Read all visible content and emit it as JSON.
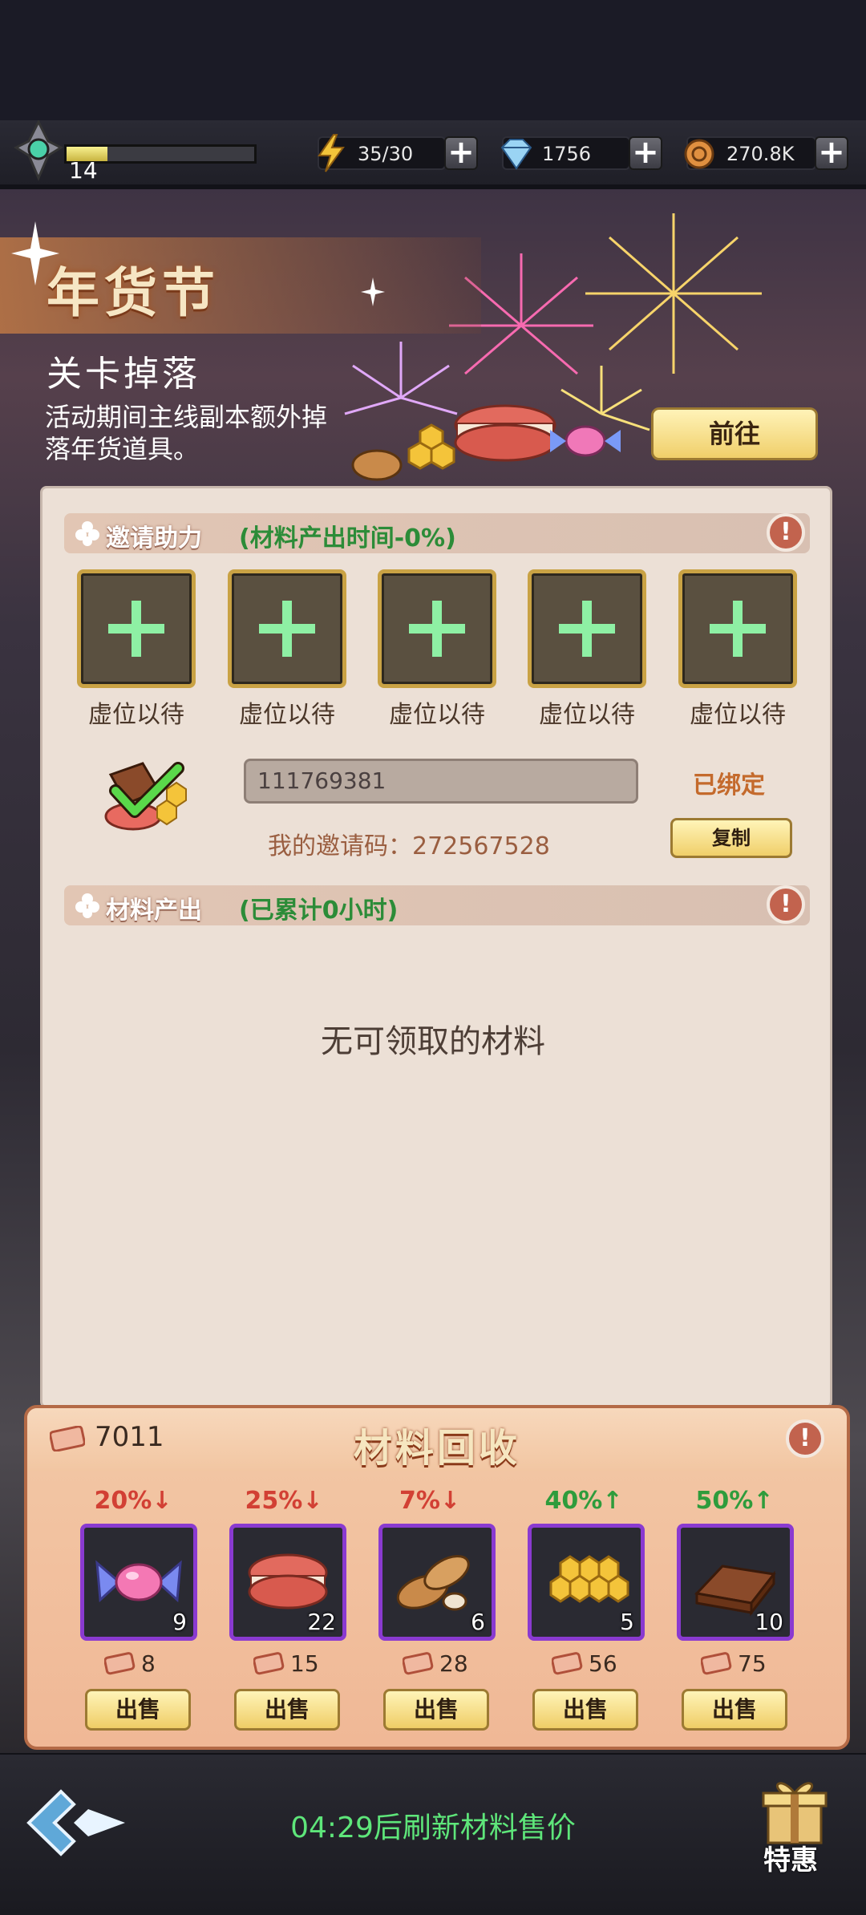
{
  "topbar": {
    "level": "14",
    "xp_progress": 0.22,
    "energy": "35/30",
    "gems": "1756",
    "coins": "270.8K"
  },
  "event": {
    "title": "年货节",
    "subtitle": "关卡掉落",
    "description": "活动期间主线副本额外掉落年货道具。",
    "goto_label": "前往"
  },
  "invite": {
    "header": "邀请助力",
    "hint": "(材料产出时间-0%)",
    "slot_label": "虚位以待",
    "slots": [
      "虚位以待",
      "虚位以待",
      "虚位以待",
      "虚位以待",
      "虚位以待"
    ],
    "bound_id": "111769381",
    "bound_status": "已绑定",
    "my_code": "我的邀请码：272567528",
    "copy_label": "复制"
  },
  "output": {
    "header": "材料产出",
    "hint": "(已累计0小时)",
    "empty_message": "无可领取的材料"
  },
  "recycle": {
    "title": "材料回收",
    "coupon_count": "7011",
    "sell_label": "出售",
    "items": [
      {
        "icon": "candy-icon",
        "rate": "20%↓",
        "trend": "down",
        "qty": "9",
        "price": "8"
      },
      {
        "icon": "macaron-icon",
        "rate": "25%↓",
        "trend": "down",
        "qty": "22",
        "price": "15"
      },
      {
        "icon": "almond-icon",
        "rate": "7%↓",
        "trend": "down",
        "qty": "6",
        "price": "28"
      },
      {
        "icon": "honeycomb-icon",
        "rate": "40%↑",
        "trend": "up",
        "qty": "5",
        "price": "56"
      },
      {
        "icon": "chocolate-icon",
        "rate": "50%↑",
        "trend": "up",
        "qty": "10",
        "price": "75"
      }
    ]
  },
  "footer": {
    "refresh_text": "04:29后刷新材料售价",
    "special_label": "特惠"
  },
  "colors": {
    "accent_gold": "#f0cf6a",
    "panel_bg": "#ece0d6",
    "rate_down": "#d24034",
    "rate_up": "#2e9c3c",
    "timer_green": "#5ee67a"
  }
}
